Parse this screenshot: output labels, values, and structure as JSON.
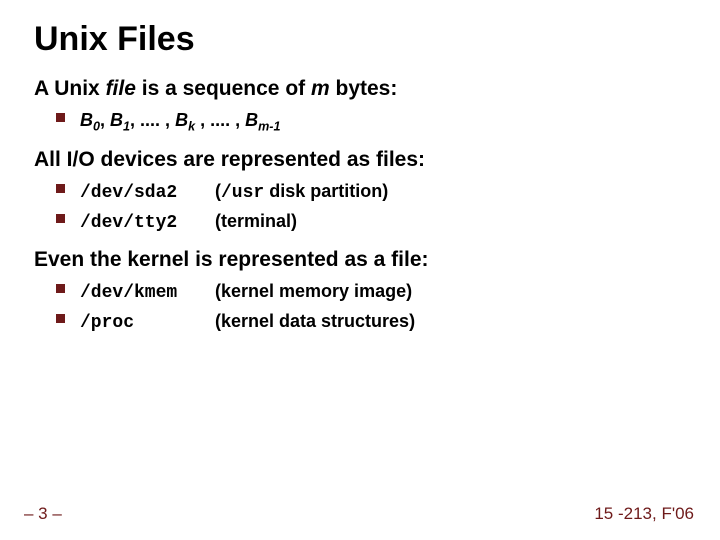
{
  "title": "Unix Files",
  "sections": [
    {
      "heading_html": "A Unix <span class=\"italic\">file</span> is a sequence of <span class=\"italic\">m</span> bytes:",
      "items": [
        {
          "html": "<span class=\"bvar\">B</span><span class=\"sub\">0</span>, <span class=\"bvar\">B</span><span class=\"sub\">1</span>, .... , <span class=\"bvar\">B</span><span class=\"sub\">k</span> , .... , <span class=\"bvar\">B</span><span class=\"sub\">m-1</span>"
        }
      ]
    },
    {
      "heading_html": "All I/O devices are represented as files:",
      "items": [
        {
          "html": "<span class=\"col-code mono\">/dev/sda2</span> (<span class=\"mono\">/usr</span> disk partition)"
        },
        {
          "html": "<span class=\"col-code mono\">/dev/tty2</span> (terminal)"
        }
      ]
    },
    {
      "heading_html": "Even the kernel is represented as a file:",
      "items": [
        {
          "html": "<span class=\"col-code mono\">/dev/kmem</span> (kernel memory image)"
        },
        {
          "html": "<span class=\"col-code mono\">/proc</span> (kernel data structures)"
        }
      ]
    }
  ],
  "footer": {
    "left": "– 3 –",
    "right": "15 -213, F'06"
  }
}
